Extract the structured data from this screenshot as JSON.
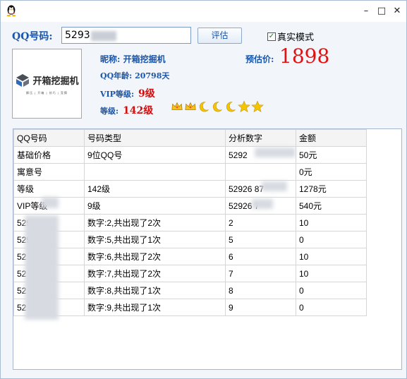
{
  "window": {
    "min": "–",
    "max": "□",
    "close": "✕"
  },
  "query": {
    "label": "QQ号码:",
    "input_value": "5293",
    "button": "评估",
    "real_mode_label": "真实模式",
    "real_mode_checked": true
  },
  "avatar": {
    "title": "开箱挖掘机",
    "subtitle": "解压 | 开箱 | 技巧 | 竞猜"
  },
  "profile": {
    "nick_label": "昵称:",
    "nick": "开箱挖掘机",
    "age_label": "QQ年龄:",
    "age": "20798天",
    "vip_label": "VIP等级:",
    "vip": "9级",
    "level_label": "等级:",
    "level": "142级",
    "est_label": "预估价:",
    "price": "1898",
    "level_icons": [
      "crown-icon",
      "crown-icon",
      "moon-icon",
      "moon-icon",
      "moon-icon",
      "star-icon",
      "star-icon"
    ]
  },
  "table": {
    "headers": [
      "QQ号码",
      "号码类型",
      "分析数字",
      "金额"
    ],
    "rows": [
      [
        "基础价格",
        "9位QQ号",
        "5292",
        "50元"
      ],
      [
        "寓意号",
        "",
        "",
        "0元"
      ],
      [
        "等级",
        "142级",
        "52926 87",
        "1278元"
      ],
      [
        "VIP等级",
        "9级",
        "52926  7",
        "540元"
      ],
      [
        "5292",
        "数字:2,共出现了2次",
        "2",
        "10"
      ],
      [
        "529",
        "数字:5,共出现了1次",
        "5",
        "0"
      ],
      [
        "52",
        "数字:6,共出现了2次",
        "6",
        "10"
      ],
      [
        "52",
        "数字:7,共出现了2次",
        "7",
        "10"
      ],
      [
        "52",
        "数字:8,共出现了1次",
        "8",
        "0"
      ],
      [
        "52",
        "数字:9,共出现了1次",
        "9",
        "0"
      ]
    ]
  },
  "colors": {
    "accent": "#1a55a8",
    "price": "#e01313",
    "vip": "#d10f0f"
  }
}
